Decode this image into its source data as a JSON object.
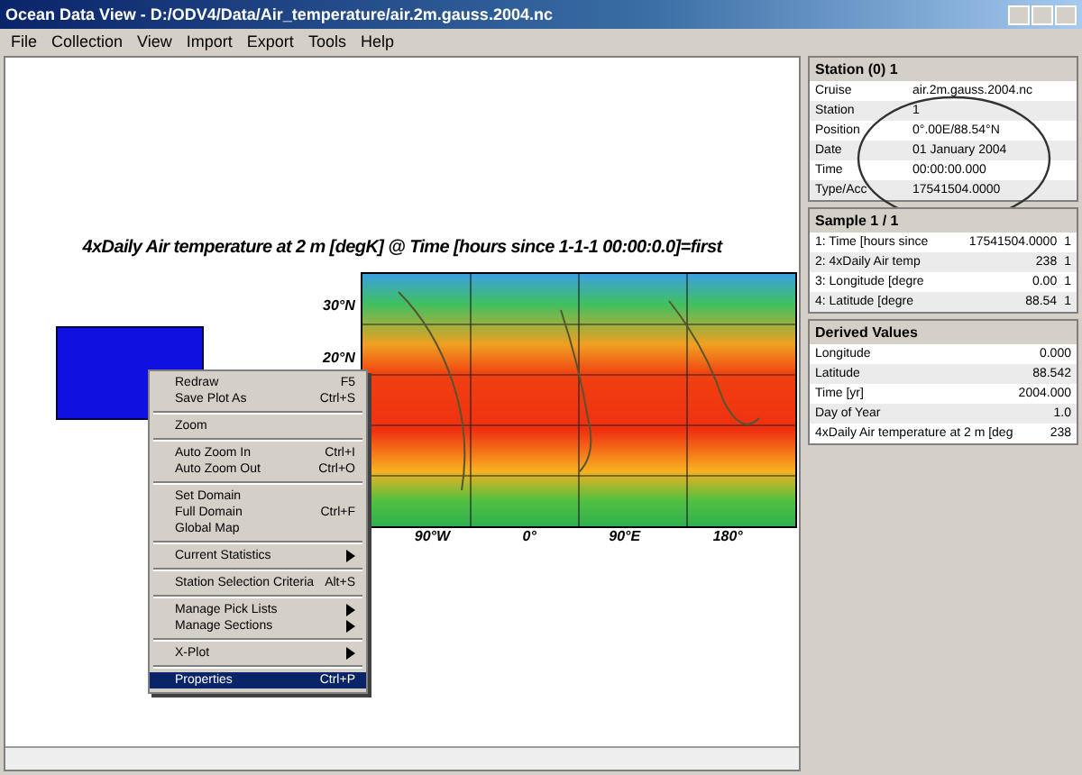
{
  "window": {
    "title": "Ocean Data View - D:/ODV4/Data/Air_temperature/air.2m.gauss.2004.nc"
  },
  "menu": [
    "File",
    "Collection",
    "View",
    "Import",
    "Export",
    "Tools",
    "Help"
  ],
  "plot": {
    "title": "4xDaily Air temperature at 2 m [degK] @ Time [hours since 1-1-1 00:00:0.0]=first",
    "lat_labels": [
      "30°N",
      "20°N"
    ],
    "lon_labels": [
      "90°W",
      "0°",
      "90°E",
      "180°"
    ]
  },
  "context_menu": [
    {
      "kind": "item",
      "label": "Redraw",
      "shortcut": "F5",
      "selected": false
    },
    {
      "kind": "item",
      "label": "Save Plot As",
      "shortcut": "Ctrl+S",
      "selected": false
    },
    {
      "kind": "separator"
    },
    {
      "kind": "item",
      "label": "Zoom",
      "selected": false
    },
    {
      "kind": "separator"
    },
    {
      "kind": "item",
      "label": "Auto Zoom In",
      "shortcut": "Ctrl+I",
      "selected": false
    },
    {
      "kind": "item",
      "label": "Auto Zoom Out",
      "shortcut": "Ctrl+O",
      "selected": false
    },
    {
      "kind": "separator"
    },
    {
      "kind": "item",
      "label": "Set Domain",
      "selected": false
    },
    {
      "kind": "item",
      "label": "Full Domain",
      "shortcut": "Ctrl+F",
      "selected": false
    },
    {
      "kind": "item",
      "label": "Global Map",
      "selected": false
    },
    {
      "kind": "separator"
    },
    {
      "kind": "submenu",
      "label": "Current Statistics",
      "selected": false
    },
    {
      "kind": "separator"
    },
    {
      "kind": "item",
      "label": "Station Selection Criteria",
      "shortcut": "Alt+S",
      "selected": false
    },
    {
      "kind": "separator"
    },
    {
      "kind": "submenu",
      "label": "Manage Pick Lists",
      "selected": false
    },
    {
      "kind": "submenu",
      "label": "Manage Sections",
      "selected": false
    },
    {
      "kind": "separator"
    },
    {
      "kind": "submenu",
      "label": "X-Plot",
      "selected": false
    },
    {
      "kind": "separator"
    },
    {
      "kind": "item",
      "label": "Properties",
      "shortcut": "Ctrl+P",
      "selected": true
    }
  ],
  "station": {
    "header": "Station (0) 1",
    "rows": [
      {
        "label": "Cruise",
        "value": "air.2m.gauss.2004.nc"
      },
      {
        "label": "Station",
        "value": "1"
      },
      {
        "label": "Position",
        "value": "0°.00E/88.54°N"
      },
      {
        "label": "Date",
        "value": "01 January 2004"
      },
      {
        "label": "Time",
        "value": "00:00:00.000"
      },
      {
        "label": "Type/Acc",
        "value": "17541504.0000"
      }
    ]
  },
  "sample": {
    "header": "Sample 1 / 1",
    "rows": [
      {
        "label": "1: Time [hours since",
        "value": "17541504.0000",
        "flag": "1"
      },
      {
        "label": "2: 4xDaily Air temp",
        "value": "238",
        "flag": "1"
      },
      {
        "label": "3: Longitude [degre",
        "value": "0.00",
        "flag": "1"
      },
      {
        "label": "4: Latitude [degre",
        "value": "88.54",
        "flag": "1"
      }
    ]
  },
  "derived": {
    "header": "Derived Values",
    "rows": [
      {
        "label": "Longitude",
        "value": "0.000"
      },
      {
        "label": "Latitude",
        "value": "88.542"
      },
      {
        "label": "Time [yr]",
        "value": "2004.000"
      },
      {
        "label": "Day of Year",
        "value": "1.0"
      },
      {
        "label": "4xDaily Air temperature at 2 m [deg",
        "value": "238"
      }
    ]
  }
}
